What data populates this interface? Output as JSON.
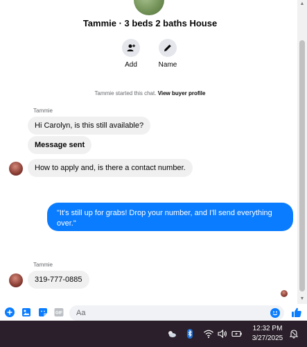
{
  "conversation": {
    "title": "Tammie · 3 beds 2 baths House",
    "actions": [
      {
        "label": "Add",
        "icon": "add-person-icon"
      },
      {
        "label": "Name",
        "icon": "pencil-icon"
      }
    ],
    "started_note": "Tammie started this chat.",
    "view_profile_link": "View buyer profile"
  },
  "messages": {
    "sender_1": "Tammie",
    "m1": "Hi Carolyn, is this still available?",
    "m2": "Message sent",
    "m3": "How to apply and, is there a contact number.",
    "outgoing_line1": "\"It's still up for grabs! Drop your number, and I'll send everything",
    "outgoing_line2": "over.\"",
    "sender_2": "Tammie",
    "m4": "319-777-0885"
  },
  "composer": {
    "placeholder": "Aa",
    "icons": [
      "plus-icon",
      "photo-icon",
      "sticker-icon",
      "gif-icon",
      "emoji-icon",
      "thumbs-up-icon"
    ],
    "gif_label": "GIF"
  },
  "taskbar": {
    "time": "12:32 PM",
    "date": "3/27/2025"
  },
  "colors": {
    "accent": "#0a7cff",
    "bubble_in": "#f0f0f0",
    "taskbar_bg": "#2a1f2a"
  }
}
